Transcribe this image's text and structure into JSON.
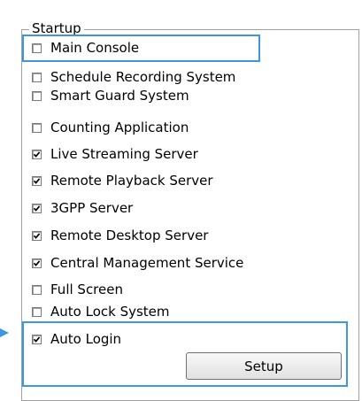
{
  "group_title": "Startup",
  "items": [
    {
      "label": "Main Console",
      "checked": false
    },
    {
      "label": "Schedule Recording System",
      "checked": false
    },
    {
      "label": "Smart Guard System",
      "checked": false
    },
    {
      "label": "Counting Application",
      "checked": false
    },
    {
      "label": "Live Streaming Server",
      "checked": true
    },
    {
      "label": "Remote Playback Server",
      "checked": true
    },
    {
      "label": "3GPP Server",
      "checked": true
    },
    {
      "label": "Remote Desktop Server",
      "checked": true
    },
    {
      "label": "Central Management Service",
      "checked": true
    },
    {
      "label": "Full Screen",
      "checked": false
    },
    {
      "label": "Auto Lock System",
      "checked": false
    },
    {
      "label": "Auto Login",
      "checked": true
    }
  ],
  "setup_button": "Setup",
  "colors": {
    "highlight": "#3d96e4",
    "checkmark": "#000000"
  }
}
